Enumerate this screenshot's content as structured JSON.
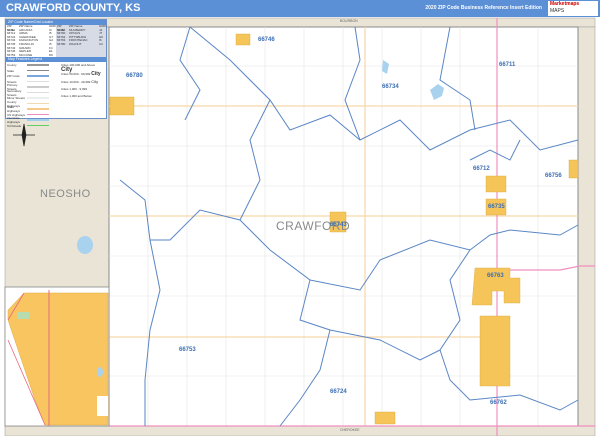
{
  "header": {
    "title": "CRAWFORD COUNTY, KS",
    "edition": "2020 ZIP Code Business Reference Insert Edition",
    "logo": "Marketmaps",
    "logo_sub": "MAPS"
  },
  "legend": {
    "zip_table_title": "ZIP Code Name/Grid Locator",
    "columns": [
      "ZIP Code",
      "ZIP Name",
      "GRID"
    ],
    "left_rows": [
      [
        "66711",
        "ARCADIA",
        "I3"
      ],
      [
        "66712",
        "ARMA",
        "I5"
      ],
      [
        "66724",
        "CHEROKEE",
        "G7"
      ],
      [
        "66734",
        "FARLINGTON",
        "G2"
      ],
      [
        "66735",
        "FRANKLIN",
        "I5"
      ],
      [
        "66743",
        "GIRARD",
        "F4"
      ],
      [
        "66746",
        "HEPLER",
        "E1"
      ],
      [
        "66753",
        "MCCUNE",
        "D6"
      ]
    ],
    "right_rows": [
      [
        "66756",
        "MULBERRY",
        "J4"
      ],
      [
        "66760",
        "OPOLIS",
        "J7"
      ],
      [
        "66762",
        "PITTSBURG",
        "H6"
      ],
      [
        "66763",
        "FRONTENAC",
        "I6"
      ],
      [
        "66780",
        "WALNUT",
        "C2"
      ]
    ],
    "features_title": "Map Features Legend",
    "features": [
      {
        "label": "County",
        "color": "#999999"
      },
      {
        "label": "State",
        "color": "#888888"
      },
      {
        "label": "ZIP Code",
        "color": "#7aa6dc"
      },
      {
        "label": "Streets",
        "color": "#dddddd"
      },
      {
        "label": "Primary Streets",
        "color": "#cccccc"
      },
      {
        "label": "Secondary Streets",
        "color": "#dddddd"
      },
      {
        "label": "Minor Streets",
        "color": "#eeeeee"
      },
      {
        "label": "County Highways",
        "color": "#f4d9b0"
      },
      {
        "label": "State Highways",
        "color": "#f7c98a"
      },
      {
        "label": "US Highways",
        "color": "#f08fc0"
      },
      {
        "label": "Interstate Highways",
        "color": "#9fd0f0"
      },
      {
        "label": "Toll Roads",
        "color": "#66cc66"
      }
    ],
    "city_sizes": [
      "Cities 100,000 and Above",
      "Cities 50,000 - 99,999",
      "Cities 10,000 - 49,999",
      "Cities 1,000 - 9,999",
      "Cities 1,000 and Below"
    ],
    "city_sample": "City"
  },
  "map": {
    "county_label": "CRAWFORD",
    "neighbor_labels": {
      "west": "NEOSHO",
      "north": "BOURBON",
      "south": "CHEROKEE"
    },
    "zips": [
      "66746",
      "66780",
      "66734",
      "66711",
      "66712",
      "66756",
      "66735",
      "66743",
      "66763",
      "66753",
      "66724",
      "66762"
    ]
  },
  "colors": {
    "header": "#5b8fd6",
    "zip_boundary": "#5a86c5",
    "city": "#f5c55a",
    "outside": "#e9e4d6",
    "us_highway": "#f08fc0",
    "state_highway": "#f7d6a8"
  }
}
